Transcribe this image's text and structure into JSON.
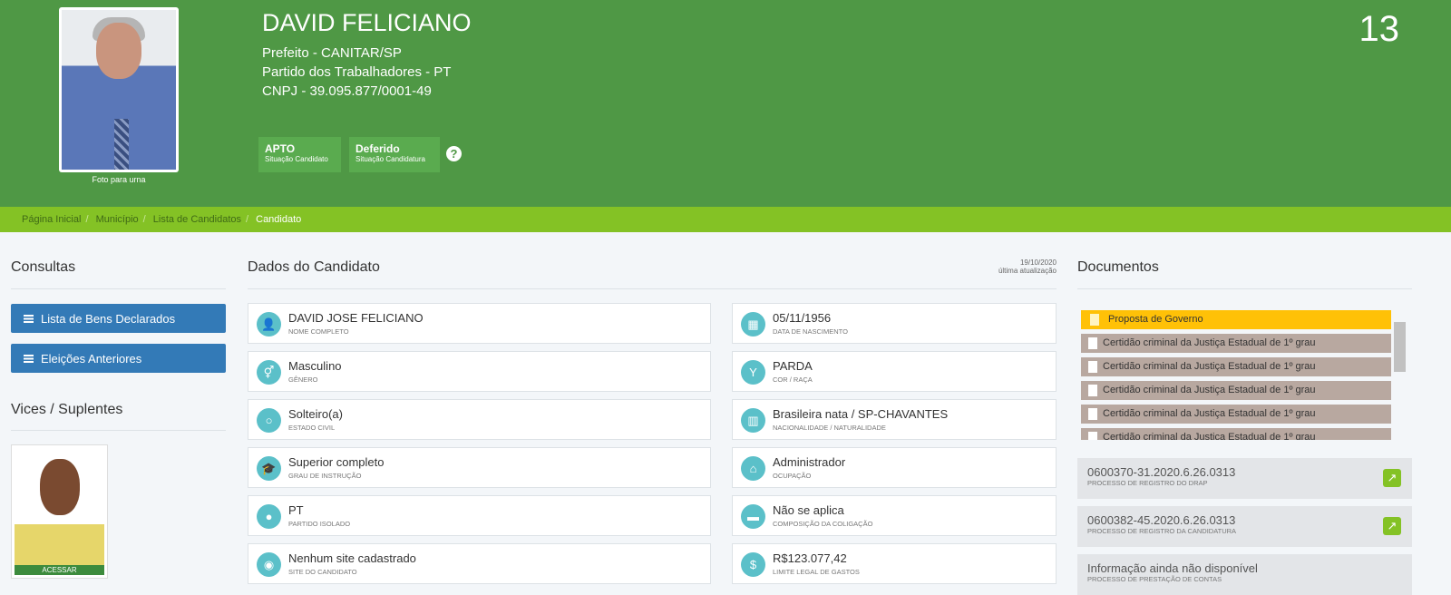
{
  "header": {
    "name": "DAVID FELICIANO",
    "role": "Prefeito - CANITAR/SP",
    "party": "Partido dos Trabalhadores - PT",
    "cnpj": "CNPJ - 39.095.877/0001-49",
    "number": "13",
    "photo_caption": "Foto para urna",
    "badges": [
      {
        "value": "APTO",
        "label": "Situação Candidato"
      },
      {
        "value": "Deferido",
        "label": "Situação Candidatura"
      }
    ],
    "help": "?"
  },
  "breadcrumb": [
    "Página Inicial",
    "Município",
    "Lista de Candidatos",
    "Candidato"
  ],
  "sidebar": {
    "consultas_title": "Consultas",
    "buttons": [
      "Lista de Bens Declarados",
      "Eleições Anteriores"
    ],
    "vices_title": "Vices / Suplentes",
    "vice_action": "ACESSAR"
  },
  "main": {
    "title": "Dados do Candidato",
    "updated_date": "19/10/2020",
    "updated_label": "última atualização",
    "fields": [
      {
        "value": "DAVID JOSE FELICIANO",
        "label": "NOME COMPLETO",
        "icon": "user-icon"
      },
      {
        "value": "05/11/1956",
        "label": "DATA DE NASCIMENTO",
        "icon": "calendar-icon"
      },
      {
        "value": "Masculino",
        "label": "GÊNERO",
        "icon": "gender-icon"
      },
      {
        "value": "PARDA",
        "label": "COR / RAÇA",
        "icon": "person-icon"
      },
      {
        "value": "Solteiro(a)",
        "label": "ESTADO CIVIL",
        "icon": "circle-icon"
      },
      {
        "value": "Brasileira nata / SP-CHAVANTES",
        "label": "NACIONALIDADE / NATURALIDADE",
        "icon": "map-icon"
      },
      {
        "value": "Superior completo",
        "label": "GRAU DE INSTRUÇÃO",
        "icon": "graduation-cap-icon"
      },
      {
        "value": "Administrador",
        "label": "OCUPAÇÃO",
        "icon": "institution-icon"
      },
      {
        "value": "PT",
        "label": "PARTIDO ISOLADO",
        "icon": "users-icon"
      },
      {
        "value": "Não se aplica",
        "label": "COMPOSIÇÃO DA COLIGAÇÃO",
        "icon": "folder-icon"
      },
      {
        "value": "Nenhum site cadastrado",
        "label": "SITE DO CANDIDATO",
        "icon": "globe-icon"
      },
      {
        "value": "R$123.077,42",
        "label": "LIMITE LEGAL DE GASTOS",
        "icon": "dollar-icon"
      }
    ]
  },
  "documents": {
    "title": "Documentos",
    "items": [
      "Proposta de Governo",
      "Certidão criminal da Justiça Estadual de 1º grau",
      "Certidão criminal da Justiça Estadual de 1º grau",
      "Certidão criminal da Justiça Estadual de 1º grau",
      "Certidão criminal da Justiça Estadual de 1º grau",
      "Certidão criminal da Justiça Estadual de 1º grau"
    ],
    "processes": [
      {
        "value": "0600370-31.2020.6.26.0313",
        "label": "PROCESSO DE REGISTRO DO DRAP"
      },
      {
        "value": "0600382-45.2020.6.26.0313",
        "label": "PROCESSO DE REGISTRO DA CANDIDATURA"
      },
      {
        "value": "Informação ainda não disponível",
        "label": "PROCESSO DE PRESTAÇÃO DE CONTAS"
      }
    ]
  }
}
